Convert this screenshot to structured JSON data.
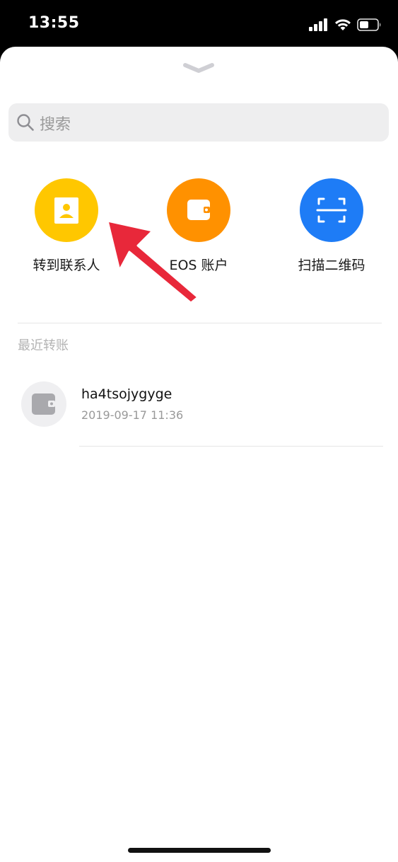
{
  "status_bar": {
    "time": "13:55",
    "icons": [
      "cellular-signal-icon",
      "wifi-icon",
      "battery-icon"
    ]
  },
  "sheet": {
    "grabber_icon": "chevron-down-icon",
    "search": {
      "placeholder": "搜索",
      "icon": "search-icon"
    },
    "actions": [
      {
        "label": "转到联系人",
        "icon": "contact-card-icon",
        "color": "#FFC700"
      },
      {
        "label": "EOS 账户",
        "icon": "wallet-icon",
        "color": "#FF9100"
      },
      {
        "label": "扫描二维码",
        "icon": "qr-scan-icon",
        "color": "#1E7CF6"
      }
    ],
    "recent": {
      "title": "最近转账",
      "items": [
        {
          "name": "ha4tsojygyge",
          "time": "2019-09-17 11:36",
          "icon": "wallet-icon"
        }
      ]
    },
    "annotation": {
      "icon": "red-arrow-icon",
      "color": "#E8283A"
    }
  }
}
